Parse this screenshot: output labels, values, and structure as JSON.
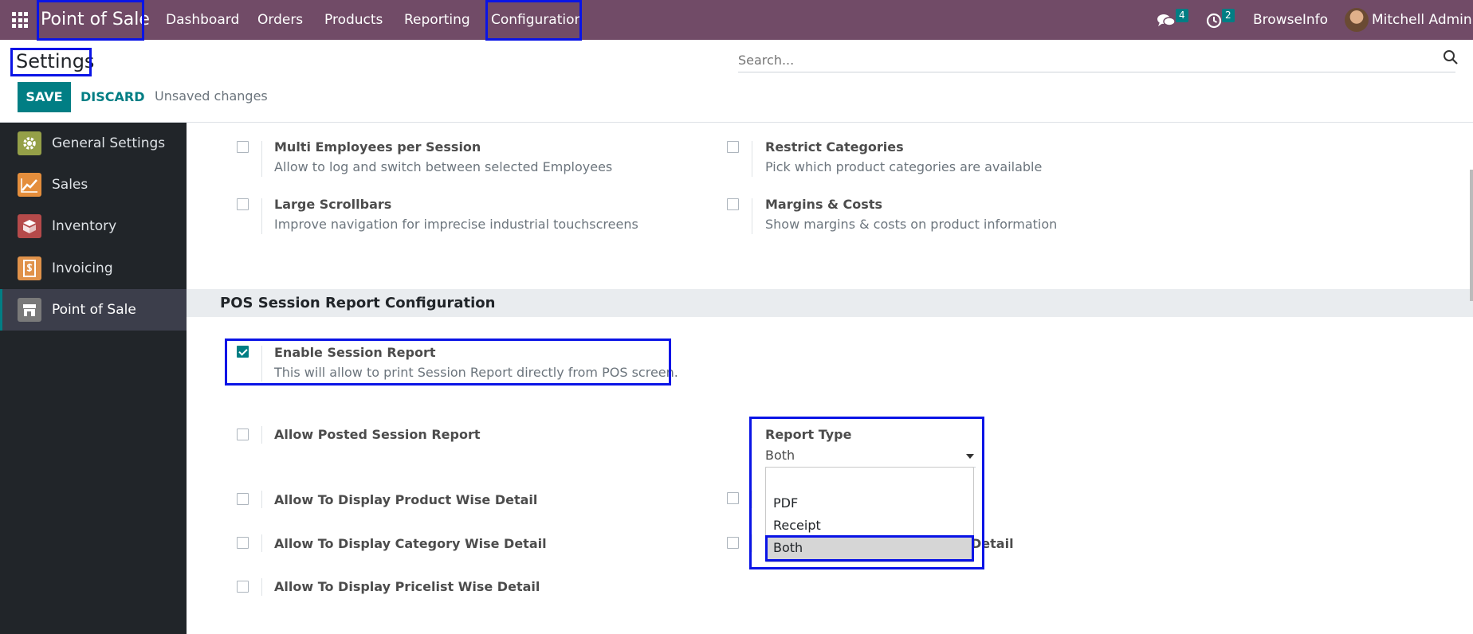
{
  "navbar": {
    "brand": "Point of Sale",
    "menu": [
      "Dashboard",
      "Orders",
      "Products",
      "Reporting",
      "Configuration"
    ],
    "messages_count": "4",
    "activities_count": "2",
    "company": "BrowseInfo",
    "user": "Mitchell Admin"
  },
  "control_panel": {
    "title": "Settings",
    "search_placeholder": "Search...",
    "save_label": "SAVE",
    "discard_label": "DISCARD",
    "status": "Unsaved changes"
  },
  "sidebar": {
    "items": [
      {
        "label": "General Settings",
        "icon": "gear-icon",
        "color": "#95a048"
      },
      {
        "label": "Sales",
        "icon": "sales-chart-icon",
        "color": "#e48e3c"
      },
      {
        "label": "Inventory",
        "icon": "inventory-box-icon",
        "color": "#b54a4a"
      },
      {
        "label": "Invoicing",
        "icon": "invoice-dollar-icon",
        "color": "#e0924a"
      },
      {
        "label": "Point of Sale",
        "icon": "store-icon",
        "color": "#7a7a7a"
      }
    ]
  },
  "options_top": [
    {
      "title": "Multi Employees per Session",
      "desc": "Allow to log and switch between selected Employees",
      "checked": false
    },
    {
      "title": "Restrict Categories",
      "desc": "Pick which product categories are available",
      "checked": false
    },
    {
      "title": "Large Scrollbars",
      "desc": "Improve navigation for imprecise industrial touchscreens",
      "checked": false
    },
    {
      "title": "Margins & Costs",
      "desc": "Show margins & costs on product information",
      "checked": false
    }
  ],
  "section": {
    "title": "POS Session Report Configuration",
    "enable": {
      "title": "Enable Session Report",
      "desc": "This will allow to print Session Report directly from POS screen.",
      "checked": true
    },
    "options": [
      {
        "title": "Allow Posted Session Report",
        "checked": false
      },
      {
        "title": "Allow To Display Product Wise Detail",
        "checked": false
      },
      {
        "title": "Allow To Display Category Wise Detail",
        "checked": false
      },
      {
        "title": "Allow To Display Pricelist Wise Detail",
        "checked": false
      }
    ],
    "right_partial_label": "Detail",
    "report_type": {
      "label": "Report Type",
      "value": "Both",
      "options": [
        "",
        "PDF",
        "Receipt",
        "Both"
      ],
      "highlighted": "Both"
    }
  },
  "colors": {
    "navbar": "#714b67",
    "primary": "#017e84",
    "annotation": "#0a14e6"
  }
}
